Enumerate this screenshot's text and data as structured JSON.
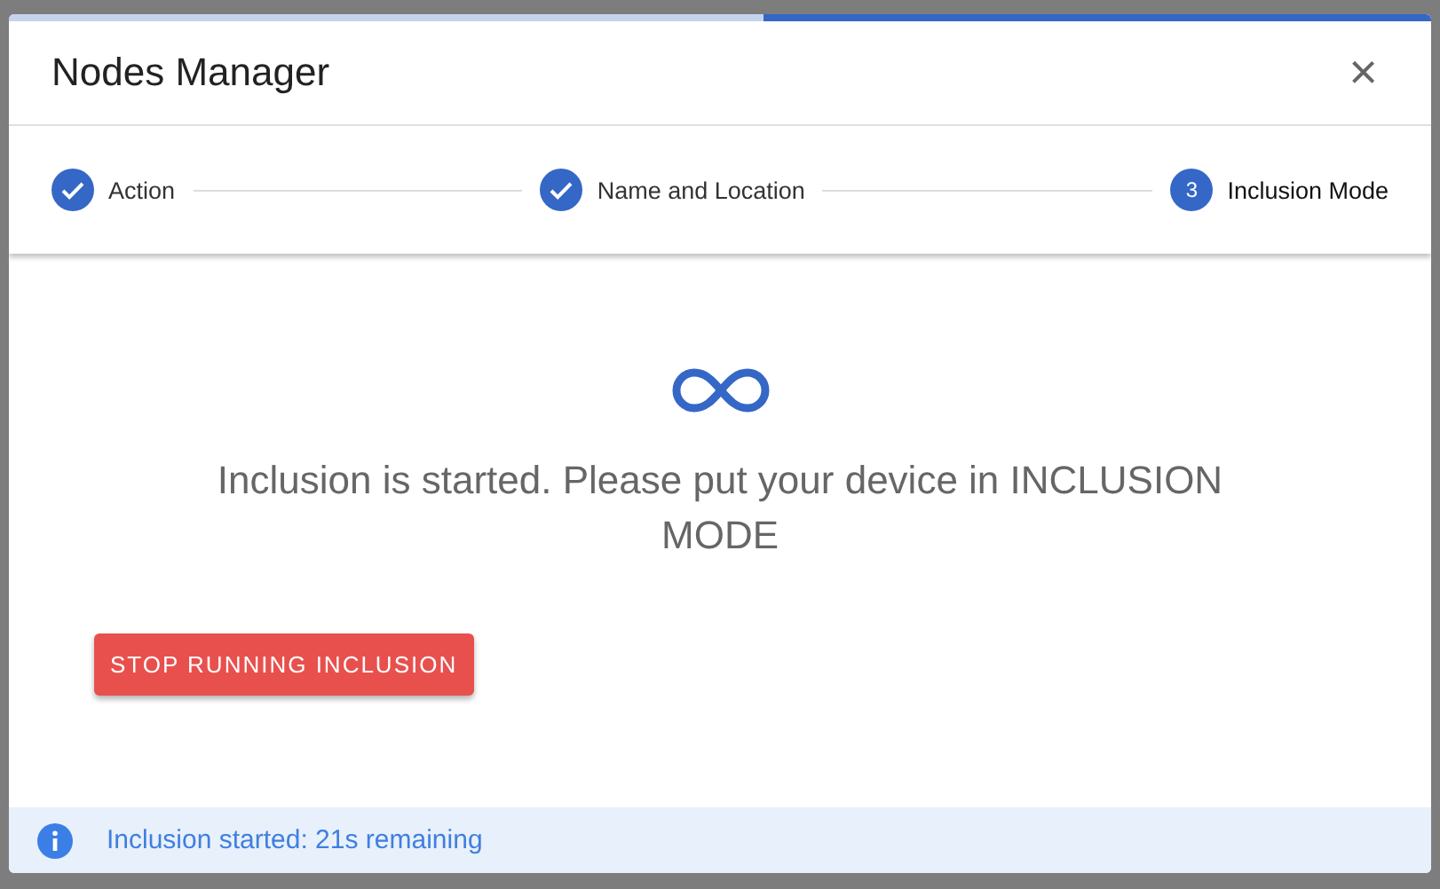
{
  "progress": {
    "level": 0.47
  },
  "dialog": {
    "title": "Nodes Manager",
    "close": "×"
  },
  "steps": [
    {
      "label": "Action",
      "complete": true,
      "selected": false
    },
    {
      "label": "Name and Location",
      "complete": true,
      "selected": false
    },
    {
      "number": "3",
      "label": "Inclusion Mode",
      "complete": false,
      "selected": true
    }
  ],
  "message": "Inclusion is started. Please put your device in INCLUSION MODE",
  "button": "STOP RUNNING INCLUSION",
  "alert": {
    "text": "Inclusion started: 21s remaining"
  }
}
